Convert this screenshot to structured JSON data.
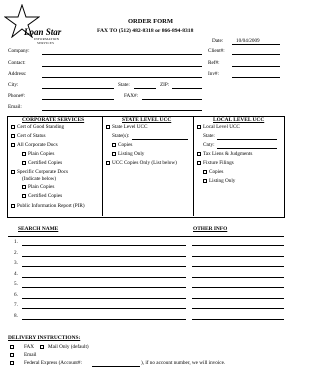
{
  "logo": {
    "name_line1": "Loan Star",
    "name_line2": "INFORMATION",
    "name_line3": "SERVICES"
  },
  "header": {
    "title": "ORDER FORM",
    "fax_line": "FAX TO (512) 482-8318 or 866-894-8318"
  },
  "date": {
    "label": "Date:",
    "value": "10/04/2009"
  },
  "fields_left": [
    {
      "label": "Company:"
    },
    {
      "label": "Contact:"
    },
    {
      "label": "Address:"
    },
    {
      "label": "City:"
    },
    {
      "label": "Phone#:"
    },
    {
      "label": "Email:"
    }
  ],
  "fields_right": [
    {
      "label": "Client#:"
    },
    {
      "label": "Ref#:"
    },
    {
      "label": "Inv#:"
    }
  ],
  "state_label": "State:",
  "zip_label": "ZIP:",
  "fax_label": "FAX#:",
  "corporate": {
    "heading": "CORPORATE SERVICES",
    "items": [
      "Cert of Good Standing",
      "Cert of Status",
      "All Corporate Docs",
      "Plain Copies",
      "Certified Copies",
      "Specific Corporate Docs",
      "(Indicate below)",
      "Plain Copies",
      "Certified Copies",
      "Public Information Report (PIR)"
    ]
  },
  "state_ucc": {
    "heading": "STATE LEVEL UCC",
    "items": [
      "State Level UCC",
      "State(s):",
      "Copies",
      "Listing Only",
      "UCC Copies Only (List below)"
    ]
  },
  "local_ucc": {
    "heading": "LOCAL LEVEL UCC",
    "items": [
      "Local Level UCC",
      "State:",
      "Cnty:",
      "Tax Liens & Judgments",
      "Fixture Filings",
      "Copies",
      "Listing Only"
    ]
  },
  "search": {
    "name_heading": "SEARCH NAME",
    "other_heading": "OTHER INFO",
    "rows": [
      "1.",
      "2.",
      "3.",
      "4.",
      "5.",
      "6.",
      "7.",
      "8."
    ]
  },
  "delivery": {
    "heading": "DELIVERY INSTRUCTIONS:",
    "fax": "FAX",
    "mail": "Mail Only (default)",
    "email": "Email",
    "fedex": "Federal Express (Account#:",
    "fedex_note": "), if no account number, we will invoice."
  }
}
